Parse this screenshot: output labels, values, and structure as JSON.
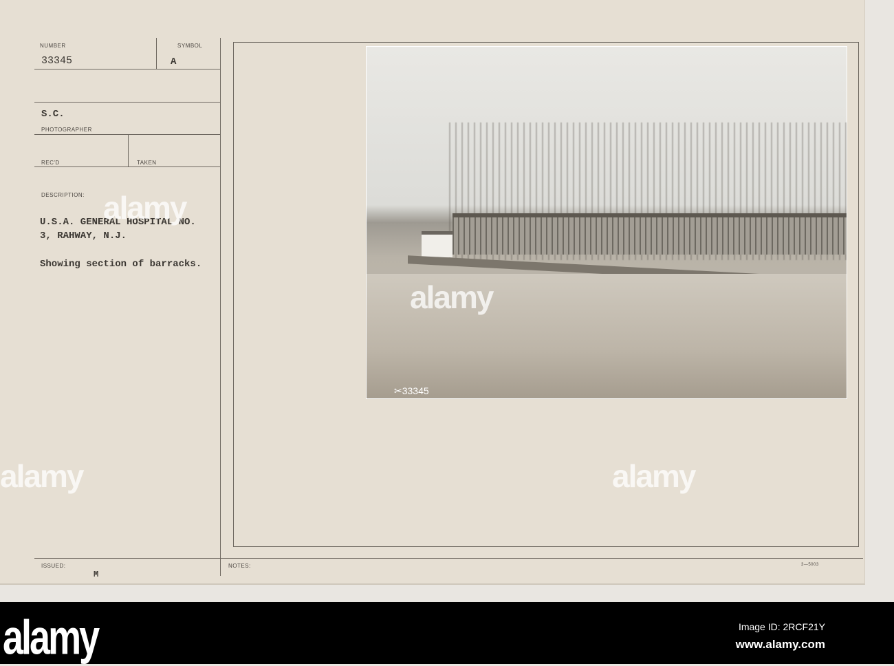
{
  "card": {
    "number_label": "NUMBER",
    "number": "33345",
    "symbol_label": "SYMBOL",
    "symbol": "A",
    "agency": "S.C.",
    "photographer_label": "PHOTOGRAPHER",
    "recd_label": "REC'D",
    "taken_label": "TAKEN",
    "description_label": "DESCRIPTION:",
    "description_line1": "U.S.A. GENERAL HOSPITAL NO.",
    "description_line2": "3, RAHWAY, N.J.",
    "caption": "Showing section of barracks.",
    "issued_label": "ISSUED:",
    "issued_mark": "M",
    "notes_label": "NOTES:",
    "form_number": "3—5003"
  },
  "photo": {
    "negative_number": "✂33345"
  },
  "watermark": {
    "text": "alamy",
    "letter": "a"
  },
  "footer": {
    "logo": "alamy",
    "image_id": "Image ID: 2RCF21Y",
    "site": "www.alamy.com"
  }
}
